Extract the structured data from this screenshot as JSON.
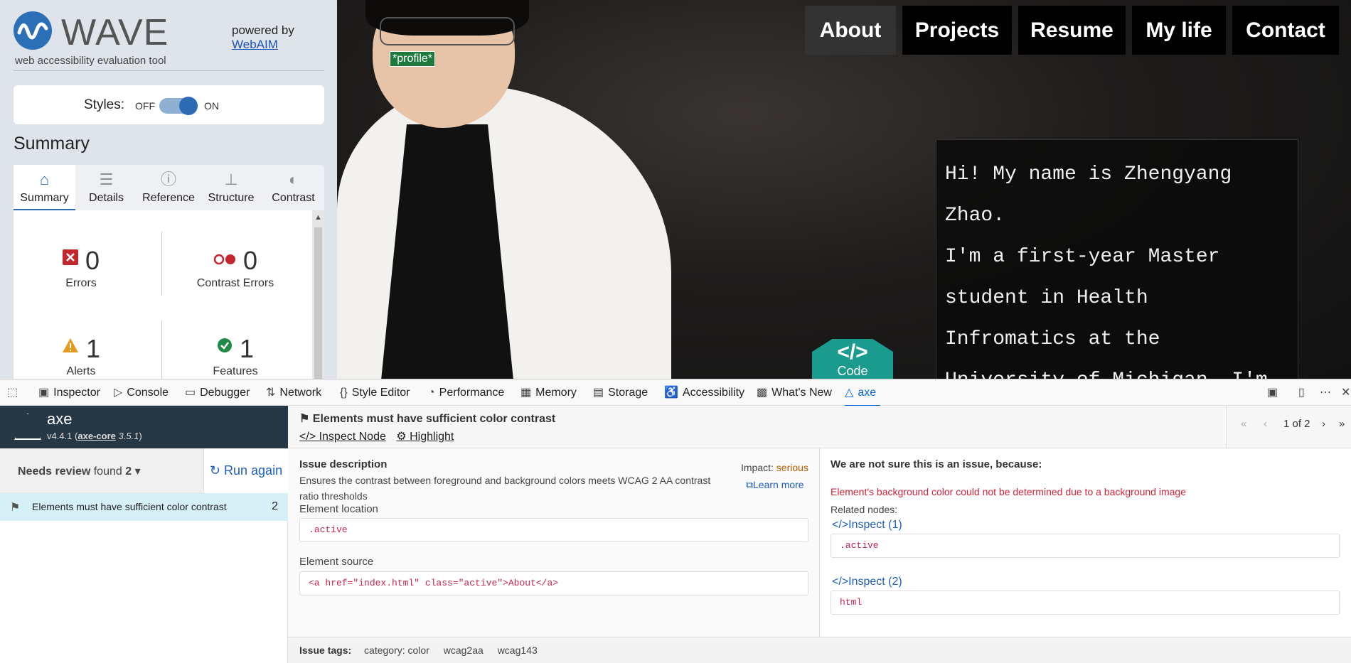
{
  "wave": {
    "logo_text": "WAVE",
    "tagline": "web accessibility evaluation tool",
    "powered_by": "powered by",
    "webaim_link": "WebAIM",
    "styles_label": "Styles:",
    "styles_off": "OFF",
    "styles_on": "ON",
    "summary_heading": "Summary",
    "tabs": [
      {
        "label": "Summary",
        "icon": "home-icon"
      },
      {
        "label": "Details",
        "icon": "list-icon"
      },
      {
        "label": "Reference",
        "icon": "info-icon"
      },
      {
        "label": "Structure",
        "icon": "structure-icon"
      },
      {
        "label": "Contrast",
        "icon": "contrast-icon"
      }
    ],
    "stats": {
      "errors": {
        "count": "0",
        "label": "Errors"
      },
      "contrast_errors": {
        "count": "0",
        "label": "Contrast Errors"
      },
      "alerts": {
        "count": "1",
        "label": "Alerts"
      },
      "features": {
        "count": "1",
        "label": "Features"
      }
    }
  },
  "site": {
    "profile_tag": "*profile*",
    "nav": [
      "About",
      "Projects",
      "Resume",
      "My life",
      "Contact"
    ],
    "intro_lines": [
      "Hi! My name is Zhengyang",
      "Zhao.",
      "I'm a first-year Master",
      "student in Health",
      "Infromatics at the",
      "University of Michigan. I'm"
    ],
    "code_badge_symbol": "</>",
    "code_badge_text": "Code"
  },
  "devtools": {
    "tools": [
      "Inspector",
      "Console",
      "Debugger",
      "Network",
      "Style Editor",
      "Performance",
      "Memory",
      "Storage",
      "Accessibility",
      "What's New",
      "axe"
    ]
  },
  "axe": {
    "name": "axe",
    "version": "v4.4.1",
    "core": "axe-core",
    "core_version": "3.5.1",
    "needs_review_label": "Needs review",
    "found_label": "found",
    "found_count": "2",
    "run_again": "Run again",
    "issue_item": {
      "title": "Elements must have sufficient color contrast",
      "count": "2"
    },
    "detail": {
      "title": "Elements must have sufficient color contrast",
      "inspect_node": "Inspect Node",
      "highlight": "Highlight",
      "pager": "1 of 2",
      "issue_desc_heading": "Issue description",
      "issue_desc": "Ensures the contrast between foreground and background colors meets WCAG 2 AA contrast ratio thresholds",
      "impact_label": "Impact:",
      "impact_value": "serious",
      "learn_more": "Learn more",
      "element_location_heading": "Element location",
      "element_location": ".active",
      "element_source_heading": "Element source",
      "element_source": "<a href=\"index.html\" class=\"active\">About</a>",
      "not_sure_heading": "We are not sure this is an issue, because:",
      "not_sure_reason": "Element's background color could not be determined due to a background image",
      "related_nodes": "Related nodes:",
      "inspect_1": "Inspect (1)",
      "node_1": ".active",
      "inspect_2": "Inspect (2)",
      "node_2": "html"
    },
    "issue_tags_label": "Issue tags:",
    "issue_tags": [
      "category: color",
      "wcag2aa",
      "wcag143"
    ]
  },
  "colors": {
    "wave_blue": "#2d6cb5",
    "axe_header": "#263746",
    "impact_serious": "#b35c00",
    "reason_red": "#d0223a"
  }
}
